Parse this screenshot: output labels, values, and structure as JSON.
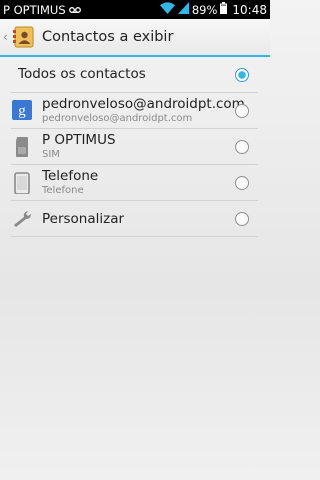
{
  "status_bar": {
    "carrier": "P OPTIMUS",
    "battery": "89%",
    "time": "10:48",
    "icons": [
      "voicemail-icon",
      "wifi-icon",
      "signal-icon",
      "battery-icon"
    ]
  },
  "action_bar": {
    "title": "Contactos a exibir",
    "app_icon": "contacts-app-icon"
  },
  "options": [
    {
      "main": "Todos os contactos",
      "sub": "",
      "icon": "",
      "selected": true
    },
    {
      "main": "pedronveloso@androidpt.com",
      "sub": "pedronveloso@androidpt.com",
      "icon": "google-icon",
      "selected": false
    },
    {
      "main": "P OPTIMUS",
      "sub": "SIM",
      "icon": "sim-card-icon",
      "selected": false
    },
    {
      "main": "Telefone",
      "sub": "Telefone",
      "icon": "phone-icon",
      "selected": false
    },
    {
      "main": "Personalizar",
      "sub": "",
      "icon": "wrench-icon",
      "selected": false
    }
  ],
  "colors": {
    "accent": "#33b5e5",
    "status_bar": "#000000"
  }
}
